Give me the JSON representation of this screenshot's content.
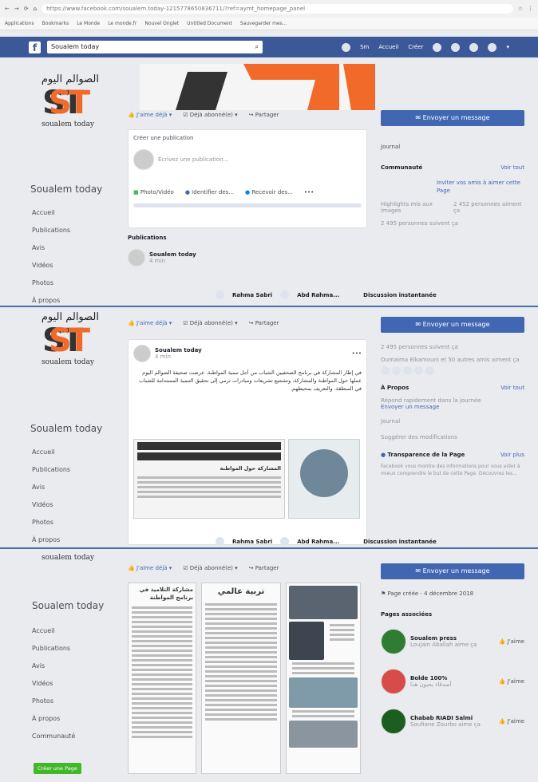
{
  "browser": {
    "url": "https://www.facebook.com/soualem.today-1215778650836711/?ref=aymt_homepage_panel",
    "bookmarks": [
      "Applications",
      "Bookmarks",
      "Le Monde",
      "Le monde.fr",
      "Nouvel Onglet",
      "Untitled Document",
      "Sauvegarder mes..."
    ]
  },
  "fbbar": {
    "search_value": "Soualem today",
    "nav": [
      "Sm",
      "Accueil",
      "Créer"
    ]
  },
  "brand": {
    "arabic": "الصوالم اليوم",
    "latin": "soualem today",
    "initials": "ST"
  },
  "section1": {
    "page_name": "Soualem today",
    "nav": [
      "Accueil",
      "Publications",
      "Avis",
      "Vidéos",
      "Photos",
      "À propos"
    ],
    "tabs": {
      "like": "J'aime déjà",
      "follow": "Déjà abonné(e)",
      "share": "Partager"
    },
    "composer": {
      "title": "Créer une publication",
      "placeholder": "Écrivez une publication...",
      "actions": [
        "Photo/Vidéo",
        "Identifier des...",
        "Recevoir des..."
      ]
    },
    "publications_label": "Publications",
    "post": {
      "name": "Soualem today",
      "time": "4 min"
    },
    "chat": [
      "Rahma Sabri",
      "Abd Rahma...",
      "Discussion instantanée"
    ],
    "right": {
      "msg": "Envoyer un message",
      "journal": "Journal",
      "community": "Communauté",
      "see_all": "Voir tout",
      "invite": "Inviter vos amis à aimer cette Page",
      "highlights": "Highlights mis aux images",
      "likes": "2 452 personnes aiment ça",
      "follows": "2 495 personnes suivent ça"
    }
  },
  "section2": {
    "page_name": "Soualem today",
    "nav": [
      "Accueil",
      "Publications",
      "Avis",
      "Vidéos",
      "Photos",
      "À propos"
    ],
    "tabs": {
      "like": "J'aime déjà",
      "follow": "Déjà abonné(e)",
      "share": "Partager"
    },
    "post": {
      "name": "Soualem today",
      "time": "4 min",
      "text": "في إطار المشاركة في برنامج الصحفيين الشباب من أجل تنمية المواطنة، عرضت صحيفة الصوالم اليوم عملها حول المواطنة والمشاركة، وتشجيع تشريعات ومبادرات ترمي إلى تحقيق التنمية المستدامة للشباب في المنطقة، والتعريف بمحيطهم."
    },
    "news_headline": "المشاركة حول المواطنة",
    "chat": [
      "Rahma Sabri",
      "Abd Rahma...",
      "Discussion instantanée"
    ],
    "right": {
      "msg": "Envoyer un message",
      "follows": "2 495 personnes suivent ça",
      "visits": "Oumaima Elkamouni et 50 autres amis aiment ça",
      "about": "À Propos",
      "see_all": "Voir tout",
      "response": "Répond rapidement dans la journée",
      "send": "Envoyer un message",
      "journal": "Journal",
      "edits": "Suggérer des modifications",
      "transparency": "Transparence de la Page",
      "see_more": "Voir plus",
      "transparency_text": "Facebook vous montre des informations pour vous aider à mieux comprendre le but de cette Page. Découvrez les..."
    }
  },
  "section3": {
    "page_name": "Soualem today",
    "nav": [
      "Accueil",
      "Publications",
      "Avis",
      "Vidéos",
      "Photos",
      "À propos",
      "Communauté"
    ],
    "create_page": "Créer une Page",
    "tabs": {
      "like": "J'aime déjà",
      "follow": "Déjà abonné(e)",
      "share": "Partager"
    },
    "news_title": "تربية عالمي",
    "news_sub": "مشاركة التلاميذ في برنامج المواطنة",
    "right": {
      "msg": "Envoyer un message",
      "created": "Page créée - 4 décembre 2018",
      "related": "Pages associées",
      "pages": [
        {
          "name": "Soualem press",
          "sub": "Loujain Aballah aime ça",
          "btn": "J'aime"
        },
        {
          "name": "Bolde 100%",
          "sub": "أصدقاء يحبون هذا",
          "btn": "J'aime"
        },
        {
          "name": "Chabab RIADI Salmi",
          "sub": "Soufiane Zourbo aime ça",
          "btn": "J'aime"
        }
      ]
    }
  }
}
